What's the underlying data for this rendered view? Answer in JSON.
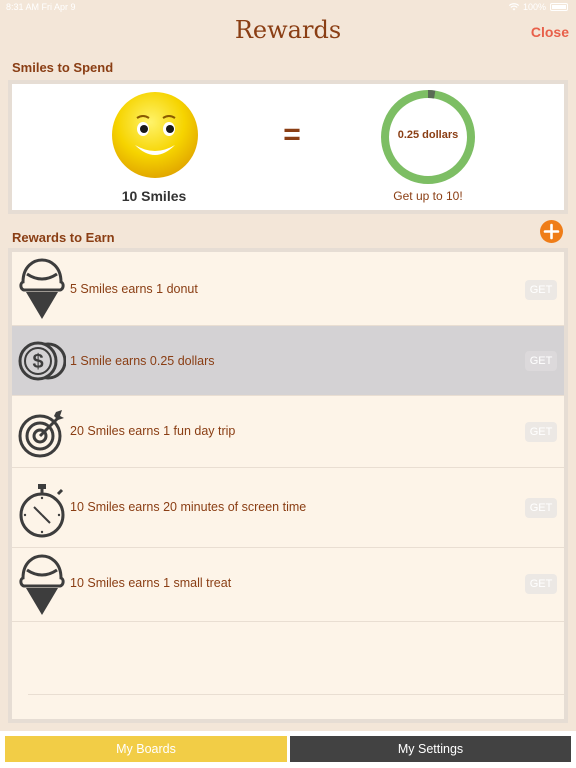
{
  "status_bar": {
    "time": "8:31 AM",
    "date": "Fri Apr 9",
    "battery": "100%"
  },
  "nav": {
    "title": "Rewards",
    "close_label": "Close"
  },
  "spend": {
    "heading": "Smiles to Spend",
    "smiles_count": "10 Smiles",
    "equals": "=",
    "ring_label": "0.25 dollars",
    "ring_progress": 0.025,
    "note": "Get up to 10!"
  },
  "earn": {
    "heading": "Rewards to Earn",
    "add_icon": "plus-icon",
    "get_label": "GET",
    "items": [
      {
        "text": "5 Smiles earns 1 donut",
        "icon": "ice-cream-icon",
        "selected": false
      },
      {
        "text": "1 Smile earns 0.25 dollars",
        "icon": "coins-icon",
        "selected": true
      },
      {
        "text": "20 Smiles earns 1 fun day trip",
        "icon": "target-icon",
        "selected": false
      },
      {
        "text": "10 Smiles earns 20 minutes of screen time",
        "icon": "stopwatch-icon",
        "selected": false
      },
      {
        "text": "10 Smiles earns 1 small treat",
        "icon": "ice-cream-icon",
        "selected": false
      }
    ]
  },
  "tabs": {
    "boards": "My Boards",
    "settings": "My Settings"
  },
  "colors": {
    "background": "#f3e6d8",
    "brown": "#8a3e14",
    "close": "#e8604a",
    "ring_green": "#7dbe64",
    "add_orange": "#ef7d18",
    "tab_yellow": "#f2cd46",
    "tab_dark": "#424242"
  }
}
